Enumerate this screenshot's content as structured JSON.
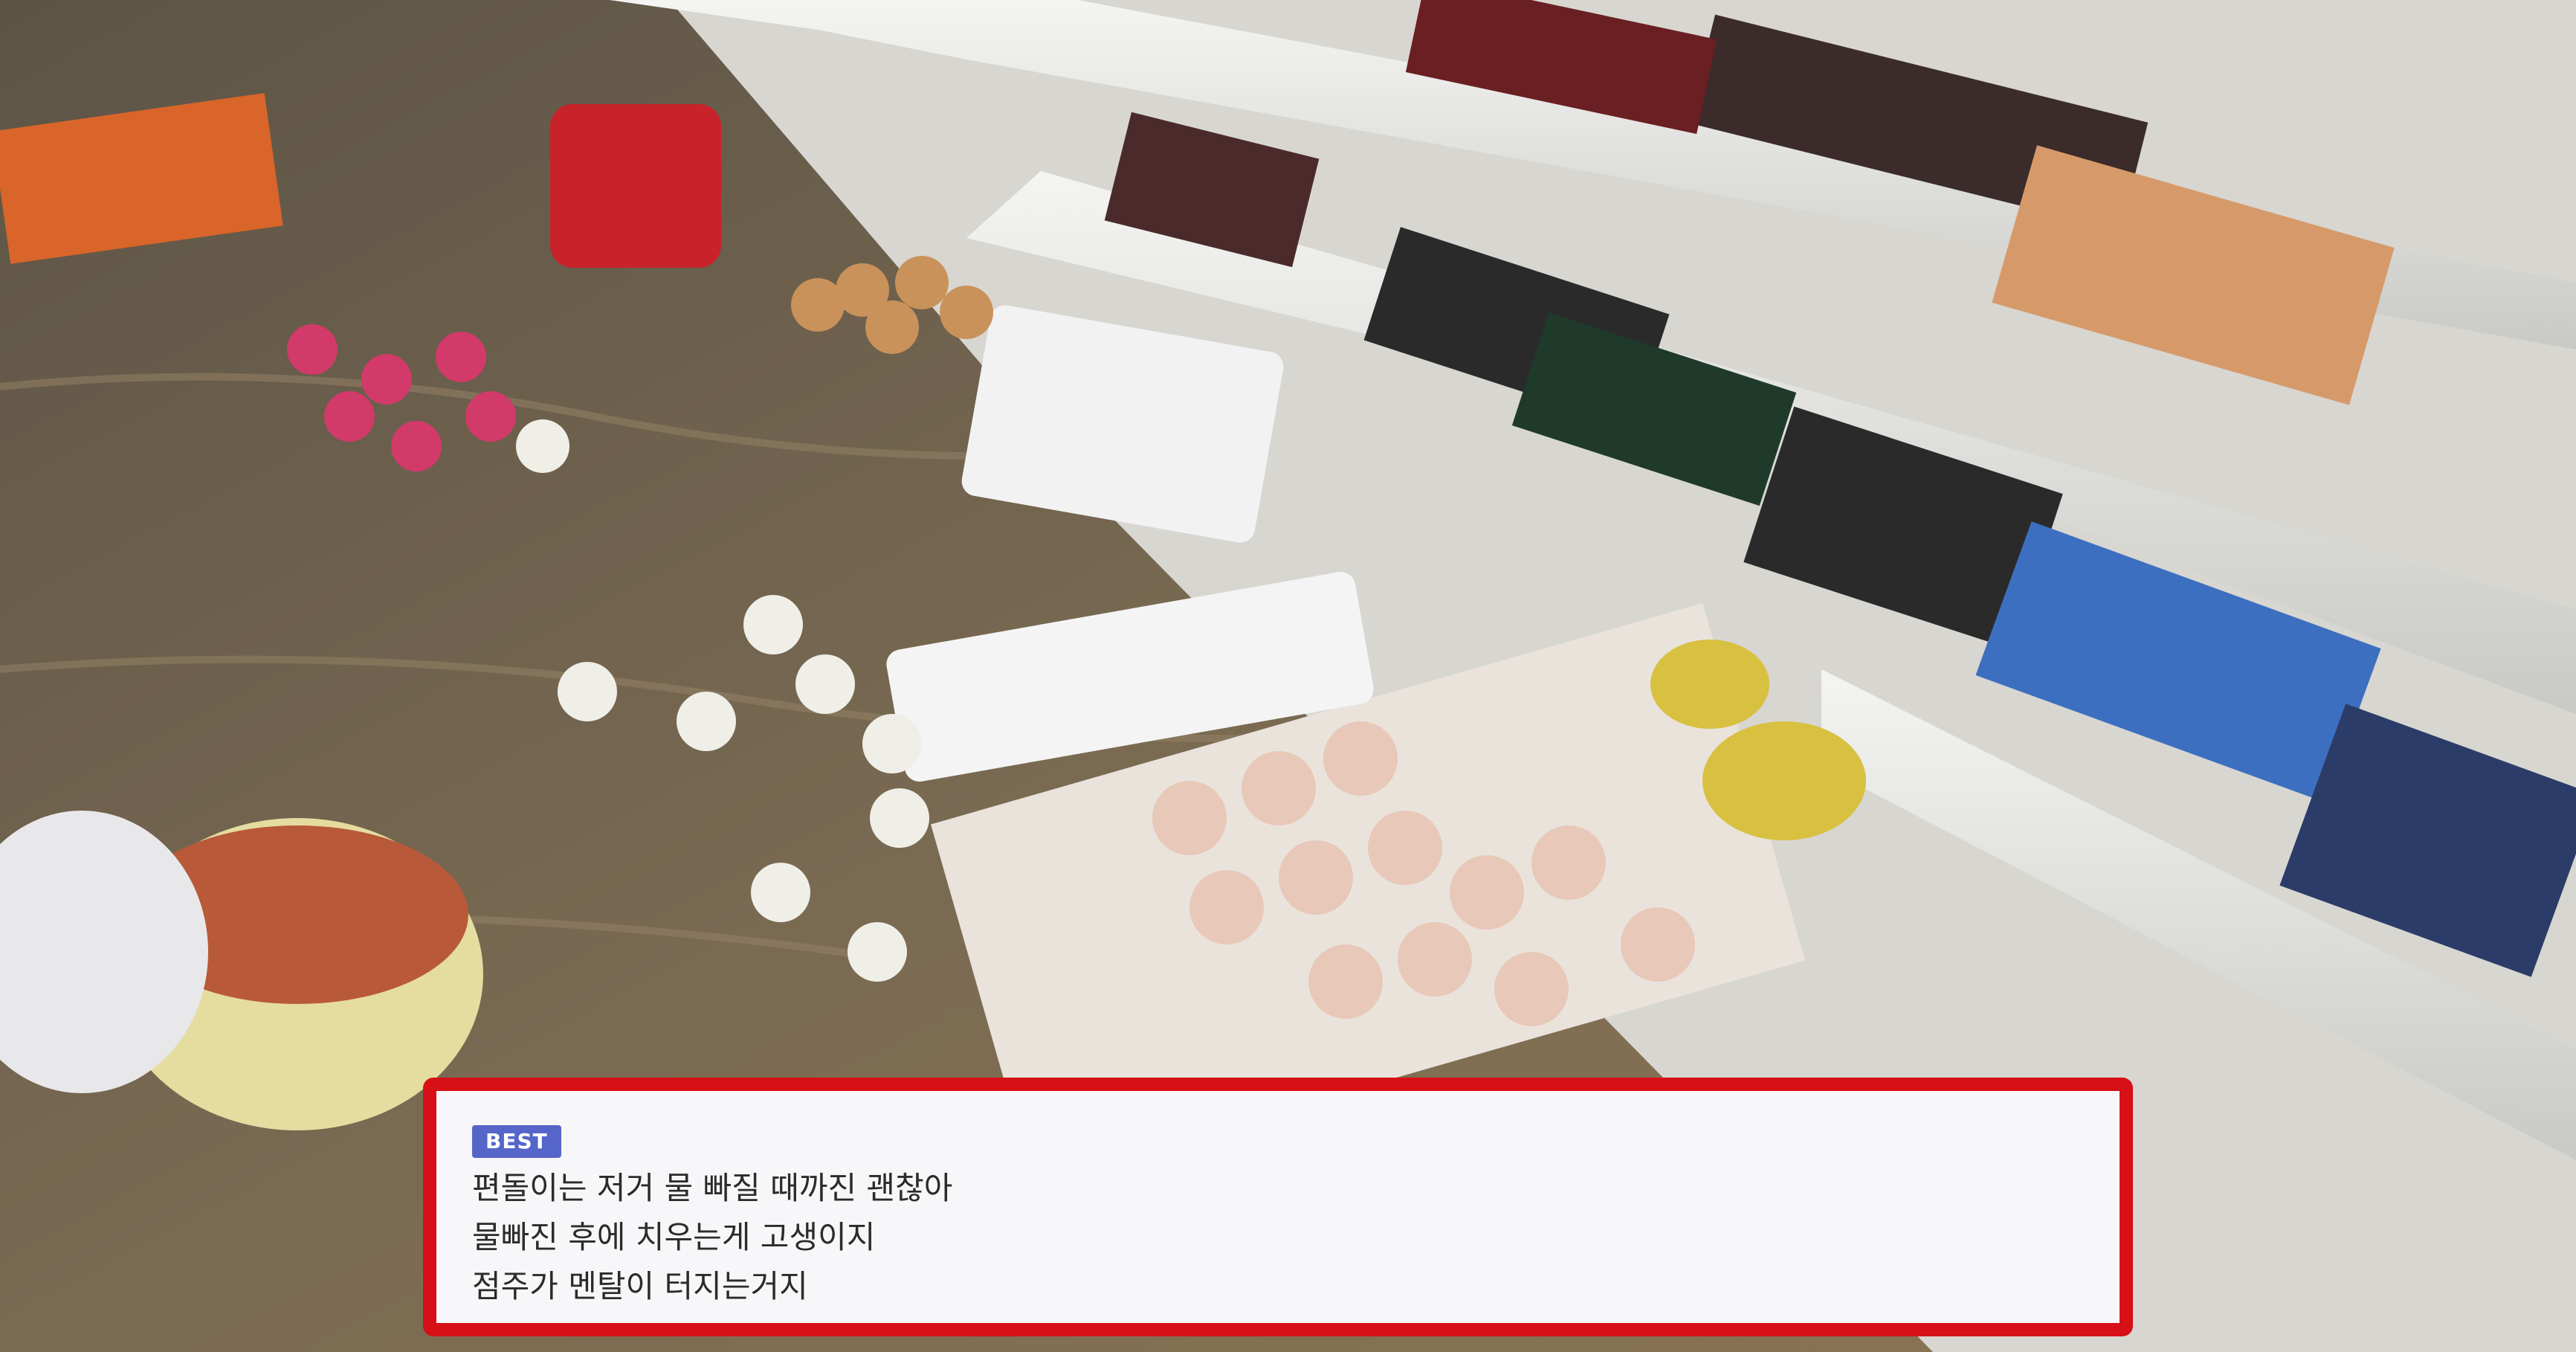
{
  "comment": {
    "badge": "BEST",
    "lines": [
      "편돌이는 저거 물 빠질 때까진 괜찮아",
      "물빠진 후에 치우는게 고생이지",
      "점주가 멘탈이 터지는거지"
    ],
    "border_color": "#d70f16",
    "badge_color": "#5566c8"
  }
}
